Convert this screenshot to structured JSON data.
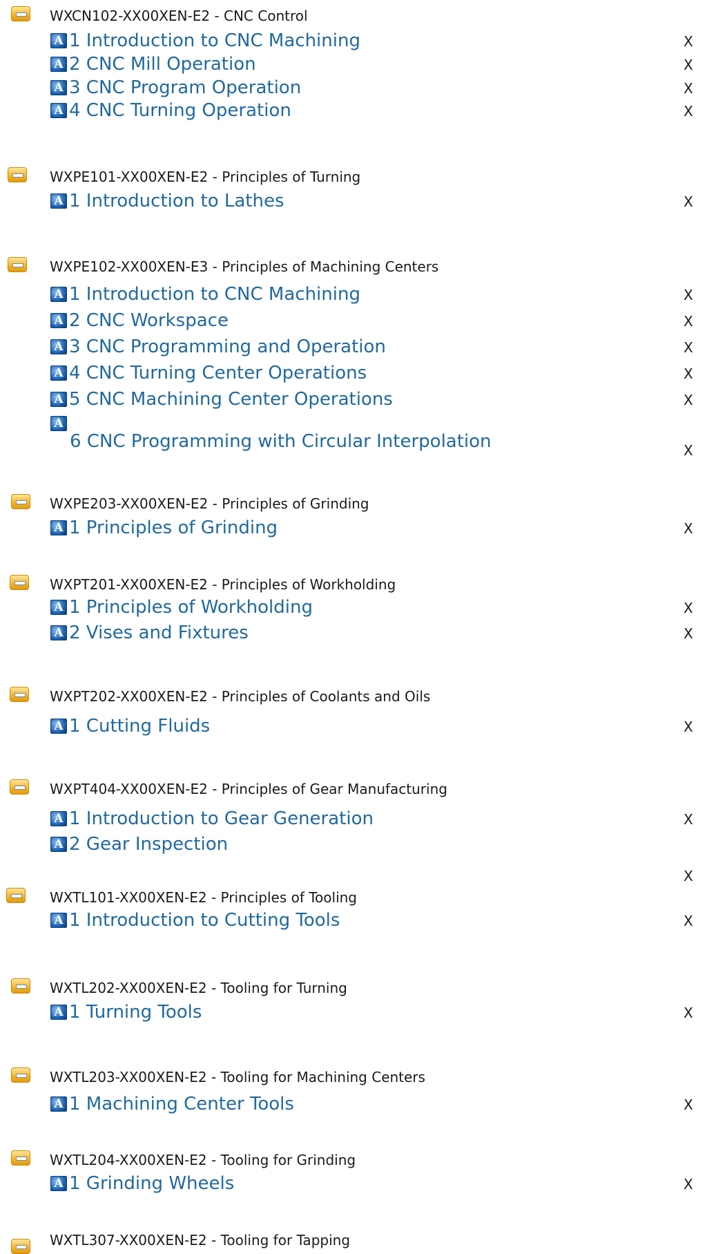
{
  "courses": [
    {
      "header": "WXCN102-XX00XEN-E2 - CNC Control",
      "lessons": [
        {
          "label": "1 Introduction to CNC Machining",
          "remove": "X"
        },
        {
          "label": "2 CNC Mill Operation",
          "remove": "X"
        },
        {
          "label": "3 CNC Program Operation",
          "remove": "X"
        },
        {
          "label": "4 CNC Turning Operation",
          "remove": "X"
        }
      ]
    },
    {
      "header": "WXPE101-XX00XEN-E2 - Principles of Turning",
      "lessons": [
        {
          "label": "1 Introduction to Lathes",
          "remove": "X"
        }
      ]
    },
    {
      "header": "WXPE102-XX00XEN-E3 - Principles of Machining Centers",
      "lessons": [
        {
          "label": "1 Introduction to CNC Machining",
          "remove": "X"
        },
        {
          "label": "2 CNC Workspace",
          "remove": "X"
        },
        {
          "label": "3 CNC Programming and Operation",
          "remove": "X"
        },
        {
          "label": "4 CNC Turning Center Operations",
          "remove": "X"
        },
        {
          "label": "5 CNC Machining Center Operations",
          "remove": "X"
        },
        {
          "label": "6 CNC Programming with Circular Interpolation",
          "remove": "X"
        }
      ]
    },
    {
      "header": "WXPE203-XX00XEN-E2 - Principles of Grinding",
      "lessons": [
        {
          "label": "1 Principles of Grinding",
          "remove": "X"
        }
      ]
    },
    {
      "header": "WXPT201-XX00XEN-E2 - Principles of Workholding",
      "lessons": [
        {
          "label": "1 Principles of Workholding",
          "remove": "X"
        },
        {
          "label": "2 Vises and Fixtures",
          "remove": "X"
        }
      ]
    },
    {
      "header": "WXPT202-XX00XEN-E2 - Principles of Coolants and Oils",
      "lessons": [
        {
          "label": "1 Cutting Fluids",
          "remove": "X"
        }
      ]
    },
    {
      "header": "WXPT404-XX00XEN-E2 - Principles of Gear Manufacturing",
      "lessons": [
        {
          "label": "1 Introduction to Gear Generation",
          "remove": "X"
        },
        {
          "label": "2 Gear Inspection",
          "remove": "X"
        }
      ]
    },
    {
      "header": "WXTL101-XX00XEN-E2 - Principles of Tooling",
      "lessons": [
        {
          "label": "1 Introduction to Cutting Tools",
          "remove": "X"
        }
      ]
    },
    {
      "header": "WXTL202-XX00XEN-E2 - Tooling for Turning",
      "lessons": [
        {
          "label": "1 Turning Tools",
          "remove": "X"
        }
      ]
    },
    {
      "header": "WXTL203-XX00XEN-E2 - Tooling for Machining Centers",
      "lessons": [
        {
          "label": "1 Machining Center Tools",
          "remove": "X"
        }
      ]
    },
    {
      "header": "WXTL204-XX00XEN-E2 - Tooling for Grinding",
      "lessons": [
        {
          "label": "1 Grinding Wheels",
          "remove": "X"
        }
      ]
    },
    {
      "header": "WXTL307-XX00XEN-E2 - Tooling for Tapping",
      "lessons": []
    }
  ],
  "lesson_icon_glyph": "A",
  "colors": {
    "link": "#20699f",
    "text": "#1a1a1a",
    "collapse_button": "#f5b323"
  }
}
